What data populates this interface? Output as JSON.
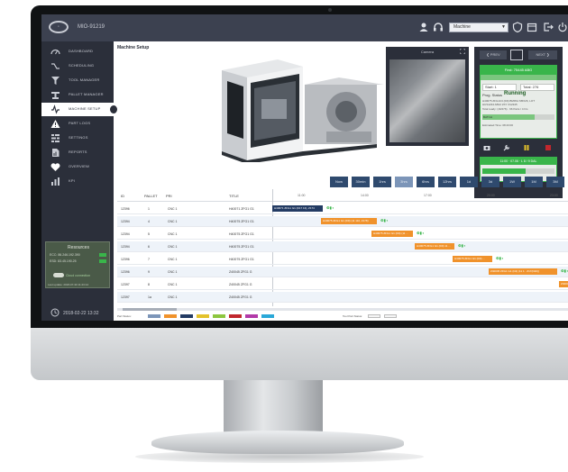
{
  "app": {
    "machine_id": "MIO-91219",
    "machine_select": "Machine"
  },
  "sidebar": {
    "items": [
      {
        "label": "DASHBOARD",
        "icon": "dashboard-icon"
      },
      {
        "label": "SCHEDULING",
        "icon": "scheduling-icon"
      },
      {
        "label": "TOOL MANAGER",
        "icon": "tool-icon"
      },
      {
        "label": "PALLET MANAGER",
        "icon": "pallet-icon"
      },
      {
        "label": "MACHINE SETUP",
        "icon": "machine-setup-icon",
        "active": true
      },
      {
        "label": "PART LOGS",
        "icon": "warning-icon"
      },
      {
        "label": "SETTINGS",
        "icon": "settings-icon"
      },
      {
        "label": "REPORTS",
        "icon": "reports-icon"
      },
      {
        "label": "OVERVIEW",
        "icon": "overview-icon"
      },
      {
        "label": "KPI",
        "icon": "kpi-icon"
      }
    ],
    "resources": {
      "title": "Resources",
      "line1": "ECC: 86.246.192.390",
      "line2": "ESD: 83.45.190.25",
      "link": "Cloud connection",
      "footer": "Last update: 2018-07-30 11:23:14"
    },
    "clock": "2018-02-22 13:32"
  },
  "main": {
    "page_title": "Machine Setup",
    "camera_title": "Camera"
  },
  "job_panel": {
    "prev": "PREV",
    "next": "NEXT",
    "header": "First: 75445 ABG",
    "field1": "Start: 1",
    "field2": "Total: 276",
    "status_label": "Prog. Status",
    "status": "Running",
    "line1": "H40075 ZFG1C3 (D9) BM9S1 M5X26, LOT",
    "line2": "HUS1234 AB12 ZXY Z12345",
    "line3": "Total ready: (16/276) · 96 Parts / 4 hrs",
    "line4": "BATCH",
    "line5": "Estimated Time: 08:43:00",
    "progress_pct": 72,
    "card2_header": "11:00 · 07.06 · L 8 / 9 DAL",
    "card2_pct": 60
  },
  "zoom": {
    "buttons": [
      "Now",
      "30min",
      "1hrs",
      "3hrs",
      "6hrs",
      "12hrs",
      "1d",
      "3d",
      "1W",
      "1M",
      "3M"
    ],
    "selected": 3
  },
  "gantt": {
    "headers": {
      "id": "ID",
      "pallet": "PALLET",
      "pri": "PRI",
      "title": "TITLE"
    },
    "times": [
      "11:00",
      "14:00",
      "17:00",
      "20:00",
      "23:00"
    ],
    "rows": [
      {
        "id": "12396",
        "pallet": "1",
        "pri": "CNC 1",
        "title": "H40071 ZFG1 G1"
      },
      {
        "id": "12394",
        "pallet": "4",
        "pri": "CNC 1",
        "title": "H40075 ZFG1 G1"
      },
      {
        "id": "12394",
        "pallet": "5",
        "pri": "CNC 1",
        "title": "H40075 ZFG1 G1"
      },
      {
        "id": "12394",
        "pallet": "6",
        "pri": "CNC 1",
        "title": "H40075 ZFG1 G1"
      },
      {
        "id": "12396",
        "pallet": "7",
        "pri": "CNC 1",
        "title": "H40075 ZFG1 G1"
      },
      {
        "id": "12396",
        "pallet": "9",
        "pri": "CNC 1",
        "title": "Z40045 ZFG1 G"
      },
      {
        "id": "12397",
        "pallet": "8",
        "pri": "CNC 1",
        "title": "Z40045 ZFG1 G"
      },
      {
        "id": "12397",
        "pallet": "1a",
        "pri": "CNC 1",
        "title": "Z40045 ZFG1 G"
      }
    ],
    "bars": [
      {
        "text": "H40071 ZFG1 G1 (D17 13), Z174",
        "color": "navy",
        "mark": "0"
      },
      {
        "text": "H40075 ZFG1 G1 (D9) (11 110, Z178)",
        "color": "orange",
        "mark": "0"
      },
      {
        "text": "H40075 ZFG1 G1 (D9) (11 ...",
        "color": "orange",
        "mark": "0"
      },
      {
        "text": "H40075 ZFG1 G1 (D9) 11 ...",
        "color": "orange",
        "mark": "0"
      },
      {
        "text": "H40075 ZFG1 G1 (D9) ...",
        "color": "orange",
        "mark": "0"
      },
      {
        "text": "Z40045 ZFG1 G1 (D4) (11 1 · Z17(D20))",
        "color": "orange",
        "mark": "0"
      },
      {
        "text": "Z40045 ZFG1 G1 (D4)",
        "color": "orange",
        "mark": ""
      },
      {
        "text": "",
        "color": "",
        "mark": ""
      }
    ]
  },
  "legend": {
    "label": "Part Status:",
    "label2": "Tool Part Status:",
    "swatches": [
      "#7c95b8",
      "#f0922b",
      "#233b63",
      "#e3c22b",
      "#8dc63f",
      "#c1272d",
      "#b23aa8",
      "#2aa8d8"
    ]
  },
  "colors": {
    "accent_green": "#39b54a",
    "orange": "#f0922b",
    "navy": "#233b63",
    "sidebar": "#2b2f3a"
  }
}
